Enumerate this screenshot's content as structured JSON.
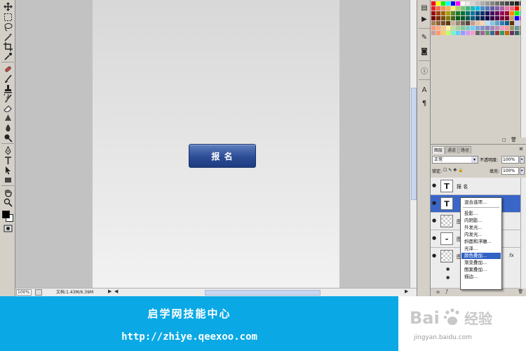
{
  "canvas": {
    "button_label": "报    名",
    "button_color": "#2c4c95"
  },
  "status_bar": {
    "zoom": "100%",
    "doc_info": "文档:1.43M/6.39M"
  },
  "layers_panel": {
    "tabs": [
      "图层",
      "通道",
      "路径"
    ],
    "active_tab": "图层",
    "blend_mode": "正常",
    "opacity_label": "不透明度:",
    "opacity": "100%",
    "lock_label": "锁定:",
    "fill_label": "填充:",
    "fill": "100%",
    "layers": [
      {
        "name": "报   名",
        "thumb": "T"
      },
      {
        "name": "",
        "thumb": "T"
      },
      {
        "name": "图",
        "thumb": ""
      },
      {
        "name": "图",
        "thumb": "-"
      },
      {
        "name": "图",
        "thumb": ""
      }
    ],
    "fx_label": "fx"
  },
  "context_menu": {
    "items": [
      "混合选项...",
      "投影...",
      "内阴影...",
      "外发光...",
      "内发光...",
      "斜面和浮雕...",
      "光泽...",
      "颜色叠加...",
      "渐变叠加...",
      "图案叠加...",
      "描边..."
    ],
    "highlighted": "颜色叠加..."
  },
  "banner": {
    "title": "启学网技能中心",
    "url": "http://zhiye.qeexoo.com",
    "background": "#0aa9e6"
  },
  "watermark": {
    "logo": "Bai 经验",
    "url": "jingyan.baidu.com"
  }
}
